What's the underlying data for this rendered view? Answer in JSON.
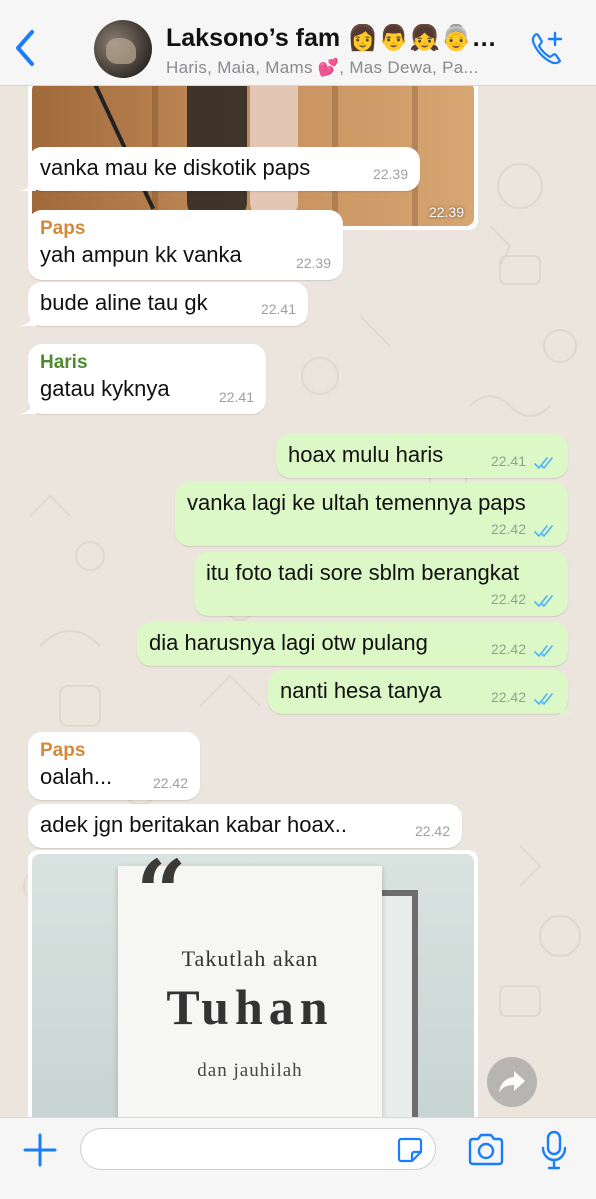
{
  "header": {
    "title": "Laksono’s fam 👩👨👧👵…",
    "subtitle": "Haris, Maia, Mams 💕, Mas Dewa, Pa...",
    "back_icon": "chevron-left-icon",
    "call_icon": "phone-plus-icon"
  },
  "colors": {
    "accent": "#1a7efb",
    "incoming_bubble": "#ffffff",
    "outgoing_bubble": "#dcf8c6",
    "paps_name": "#d48a3a",
    "haris_name": "#4f8a2e",
    "read_ticks": "#4fb3f6",
    "chat_bg": "#ece5dd"
  },
  "photo_top": {
    "time": "22.39"
  },
  "messages": [
    {
      "id": "m1",
      "direction": "in",
      "sender": "",
      "text": "vanka mau ke diskotik paps",
      "time": "22.39"
    },
    {
      "id": "m2",
      "direction": "in",
      "sender": "Paps",
      "text": "yah ampun kk vanka",
      "time": "22.39"
    },
    {
      "id": "m3",
      "direction": "in",
      "sender": "",
      "text": "bude aline tau gk",
      "time": "22.41"
    },
    {
      "id": "m4",
      "direction": "in",
      "sender": "Haris",
      "text": "gatau kyknya",
      "time": "22.41"
    },
    {
      "id": "m5",
      "direction": "out",
      "text": "hoax mulu haris",
      "time": "22.41"
    },
    {
      "id": "m6",
      "direction": "out",
      "text": "vanka lagi ke ultah temennya paps",
      "time": "22.42"
    },
    {
      "id": "m7",
      "direction": "out",
      "text": "itu foto tadi sore sblm berangkat",
      "time": "22.42"
    },
    {
      "id": "m8",
      "direction": "out",
      "text": "dia harusnya lagi otw pulang",
      "time": "22.42"
    },
    {
      "id": "m9",
      "direction": "out",
      "text": "nanti hesa tanya",
      "time": "22.42"
    },
    {
      "id": "m10",
      "direction": "in",
      "sender": "Paps",
      "text": "oalah...",
      "time": "22.42"
    },
    {
      "id": "m11",
      "direction": "in",
      "sender": "",
      "text": "adek jgn beritakan kabar hoax..",
      "time": "22.42"
    }
  ],
  "quote_image": {
    "mark": "“",
    "line1": "Takutlah akan",
    "line2": "Tuhan",
    "line3": "dan jauhilah"
  },
  "input_bar": {
    "placeholder": "",
    "value": "",
    "icons": [
      "plus-icon",
      "sticker-icon",
      "camera-icon",
      "microphone-icon"
    ]
  }
}
